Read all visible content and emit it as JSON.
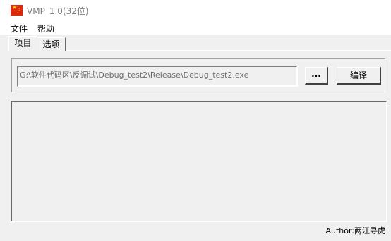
{
  "window": {
    "title": "VMP_1.0(32位)",
    "icon": "china-flag-icon"
  },
  "menu": {
    "items": [
      "文件",
      "帮助"
    ]
  },
  "tabs": [
    {
      "label": "项目",
      "active": true
    },
    {
      "label": "选项",
      "active": false
    }
  ],
  "project": {
    "path_value": "G:\\软件代码区\\反调试\\Debug_test2\\Release\\Debug_test2.exe",
    "browse_label": "...",
    "compile_label": "编译"
  },
  "log": {
    "content": ""
  },
  "footer": {
    "author": "Author:两江寻虎"
  }
}
